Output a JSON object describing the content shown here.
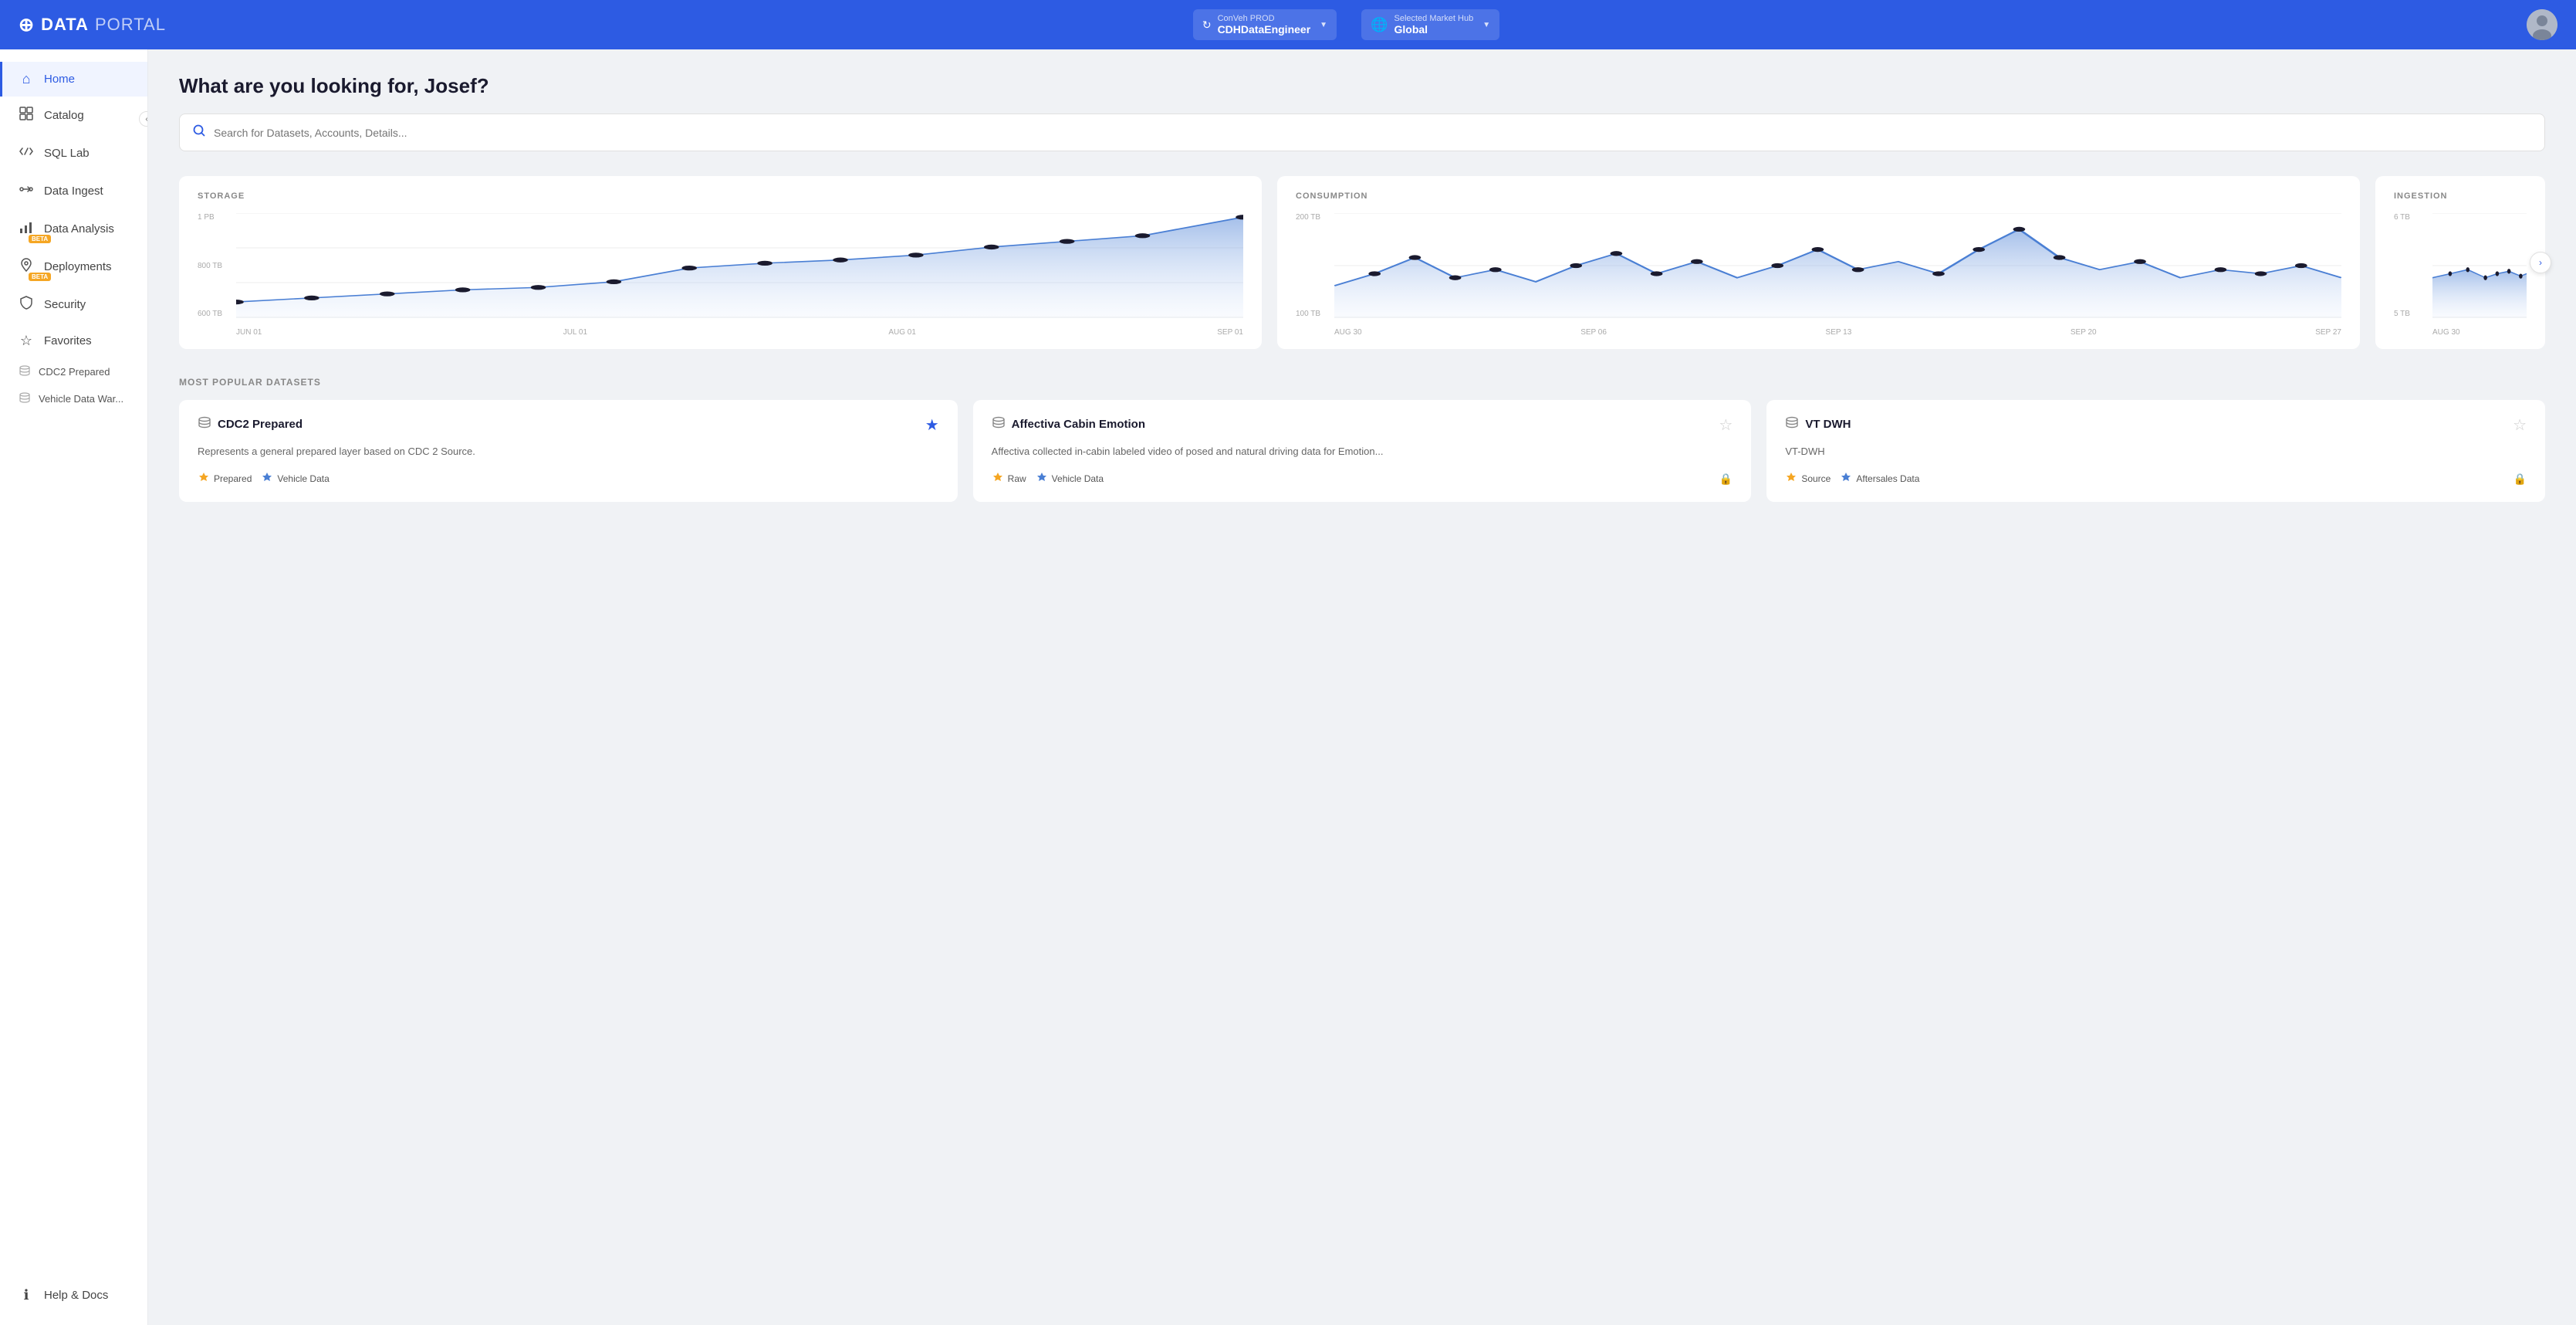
{
  "header": {
    "logo_icon": "⊕",
    "logo_data": "DATA",
    "logo_portal": "PORTAL",
    "env_label": "ConVeh PROD",
    "env_value": "CDHDataEngineer",
    "market_label": "Selected Market Hub",
    "market_value": "Global"
  },
  "sidebar": {
    "collapse_icon": "‹",
    "items": [
      {
        "id": "home",
        "label": "Home",
        "icon": "🏠",
        "active": true,
        "beta": false
      },
      {
        "id": "catalog",
        "label": "Catalog",
        "icon": "⊞",
        "active": false,
        "beta": false
      },
      {
        "id": "sql-lab",
        "label": "SQL Lab",
        "icon": "⬡",
        "active": false,
        "beta": false
      },
      {
        "id": "data-ingest",
        "label": "Data Ingest",
        "icon": "→",
        "active": false,
        "beta": false
      },
      {
        "id": "data-analysis",
        "label": "Data Analysis",
        "icon": "📊",
        "active": false,
        "beta": true
      },
      {
        "id": "deployments",
        "label": "Deployments",
        "icon": "✦",
        "active": false,
        "beta": true
      },
      {
        "id": "security",
        "label": "Security",
        "icon": "🛡",
        "active": false,
        "beta": false
      },
      {
        "id": "favorites",
        "label": "Favorites",
        "icon": "★",
        "active": false,
        "beta": false
      }
    ],
    "sub_items": [
      {
        "id": "cdc2-prepared",
        "label": "CDC2 Prepared",
        "icon": "🗄"
      },
      {
        "id": "vehicle-data-war",
        "label": "Vehicle Data War...",
        "icon": "🗄"
      }
    ],
    "bottom_items": [
      {
        "id": "help-docs",
        "label": "Help & Docs",
        "icon": "ℹ"
      }
    ]
  },
  "main": {
    "greeting": "What are you looking for, Josef?",
    "search_placeholder": "Search for Datasets, Accounts, Details...",
    "charts": [
      {
        "id": "storage",
        "title": "STORAGE",
        "y_labels": [
          "1 PB",
          "800 TB",
          "600 TB"
        ],
        "x_labels": [
          "JUN 01",
          "JUL 01",
          "AUG 01",
          "SEP 01"
        ],
        "has_nav": false
      },
      {
        "id": "consumption",
        "title": "CONSUMPTION",
        "y_labels": [
          "200 TB",
          "100 TB"
        ],
        "x_labels": [
          "AUG 30",
          "SEP 06",
          "SEP 13",
          "SEP 20",
          "SEP 27"
        ],
        "has_nav": false
      },
      {
        "id": "ingestion",
        "title": "INGESTION",
        "y_labels": [
          "6 TB",
          "5 TB"
        ],
        "x_labels": [
          "AUG 30"
        ],
        "has_nav": true
      }
    ],
    "datasets_section_title": "MOST POPULAR DATASETS",
    "datasets": [
      {
        "id": "cdc2-prepared",
        "name": "CDC2 Prepared",
        "icon": "🗄",
        "starred": true,
        "description": "Represents a general prepared layer based on CDC 2 Source.",
        "tags": [
          {
            "label": "Prepared",
            "icon": "🔶"
          },
          {
            "label": "Vehicle Data",
            "icon": "🔷"
          }
        ],
        "locked": false
      },
      {
        "id": "affectiva-cabin-emotion",
        "name": "Affectiva Cabin Emotion",
        "icon": "🗄",
        "starred": false,
        "description": "Affectiva collected in-cabin labeled video of posed and natural driving data for Emotion...",
        "tags": [
          {
            "label": "Raw",
            "icon": "🔶"
          },
          {
            "label": "Vehicle Data",
            "icon": "🔷"
          }
        ],
        "locked": true
      },
      {
        "id": "vt-dwh",
        "name": "VT DWH",
        "icon": "🗄",
        "starred": false,
        "description": "VT-DWH",
        "tags": [
          {
            "label": "Source",
            "icon": "🔶"
          },
          {
            "label": "Aftersales Data",
            "icon": "🔷"
          }
        ],
        "locked": true
      }
    ]
  }
}
